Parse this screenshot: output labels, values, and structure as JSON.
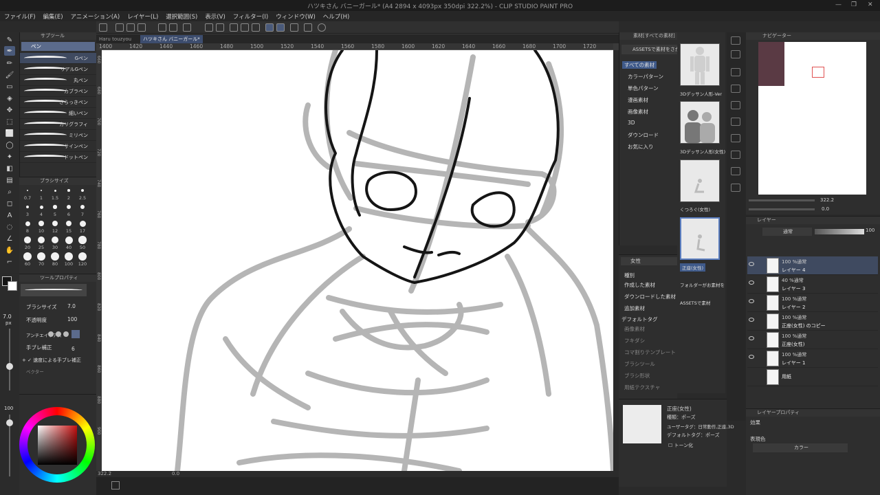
{
  "app": {
    "title": "ハツキさん バニーガール* (A4 2894 x 4093px 350dpi 322.2%) - CLIP STUDIO PAINT PRO"
  },
  "menu": [
    "ファイル(F)",
    "編集(E)",
    "アニメーション(A)",
    "レイヤー(L)",
    "選択範囲(S)",
    "表示(V)",
    "フィルター(I)",
    "ウィンドウ(W)",
    "ヘルプ(H)"
  ],
  "tabs": [
    "Haru touzyou",
    "ハツキさん バニーガール*"
  ],
  "ruler": [
    "1400",
    "1420",
    "1440",
    "1460",
    "1480",
    "1500",
    "1520",
    "1540",
    "1560",
    "1580",
    "1600",
    "1620",
    "1640",
    "1660",
    "1680",
    "1700",
    "1720"
  ],
  "vruler": [
    "660",
    "680",
    "700",
    "720",
    "740",
    "760",
    "780",
    "800",
    "820",
    "840",
    "860",
    "880",
    "900"
  ],
  "subtool": {
    "panel": "サブツール",
    "group": "ペン",
    "brushes": [
      "Gペン",
      "リアルGペン",
      "丸ペン",
      "カブラペン",
      "さらっきペン",
      "細いペン",
      "カリグラフィ",
      "ミリペン",
      "サインペン",
      "ドットペン"
    ]
  },
  "brushsize": {
    "title": "ブラシサイズ",
    "sizes": [
      "0.7",
      "1",
      "1.5",
      "2",
      "2.5",
      "3",
      "4",
      "5",
      "6",
      "7",
      "8",
      "10",
      "12",
      "15",
      "17",
      "20",
      "25",
      "30",
      "40",
      "50",
      "60",
      "70",
      "80",
      "100",
      "120"
    ]
  },
  "toolprops": {
    "title": "ツールプロパティ",
    "brush_size_label": "ブラシサイズ",
    "brush_size": "7.0",
    "opacity_label": "不透明度",
    "opacity": "100",
    "antialias_label": "アンチエイリアス",
    "stabilize_label": "手ブレ補正",
    "stabilize": "6",
    "speed_label": "速度による手ブレ補正",
    "vector_label": "ベクター"
  },
  "leftbar": {
    "size_value": "7.0",
    "size_unit": "px",
    "opacity_value": "100"
  },
  "colors": {
    "main": "#151515",
    "sub": "#ffffff",
    "accent": "#5b6b8c",
    "hue": "#c81010"
  },
  "footer": {
    "zoom": "322.2",
    "angle": "0.0"
  },
  "material": {
    "panel": "素材[すべての素材]",
    "assets_button": "ASSETSで素材をさがす",
    "tree": [
      "すべての素材",
      "カラーパターン",
      "単色パターン",
      "漫画素材",
      "画像素材",
      "3D",
      "ダウンロード",
      "お気に入り"
    ],
    "thumbs": [
      "3Dデッサン人形-Ver",
      "3Dデッサン人形(女性)",
      "くつろぐ(女性)",
      "正座(女性)"
    ],
    "thumb_extra": "フォルダーがお素材を",
    "assets_link": "ASSETSで素材"
  },
  "tags": {
    "search": "女性",
    "type_label": "種別",
    "types": [
      "作成した素材",
      "ダウンロードした素材",
      "追加素材"
    ],
    "default_tag_label": "デフォルトタグ",
    "default_tags": [
      "画像素材",
      "フキダシ",
      "コマ割りテンプレート",
      "ブラシツール",
      "ブラシ形状",
      "用紙テクスチャ"
    ]
  },
  "info": {
    "name": "正座(女性)",
    "type": "種類：ポーズ",
    "user_tags": "ユーザータグ：日常動作,正座,3D",
    "default_tags": "デフォルトタグ：ポーズ",
    "tone": "トーン化"
  },
  "navigator": {
    "panel": "ナビゲーター",
    "zoom": "322.2",
    "angle": "0.0"
  },
  "layers": {
    "panel": "レイヤー",
    "blend": "通常",
    "opacity": "100",
    "items": [
      {
        "mode": "100 %通常",
        "name": "レイヤー 4"
      },
      {
        "mode": "40 %通常",
        "name": "レイヤー 3"
      },
      {
        "mode": "100 %通常",
        "name": "レイヤー 2"
      },
      {
        "mode": "100 %通常",
        "name": "正座(女性) のコピー"
      },
      {
        "mode": "100 %通常",
        "name": "正座(女性)"
      },
      {
        "mode": "100 %通常",
        "name": "レイヤー 1"
      },
      {
        "mode": "",
        "name": "用紙"
      }
    ]
  },
  "layerprops": {
    "panel": "レイヤープロパティ",
    "effect": "効果",
    "color_label": "表現色",
    "color_value": "カラー"
  }
}
